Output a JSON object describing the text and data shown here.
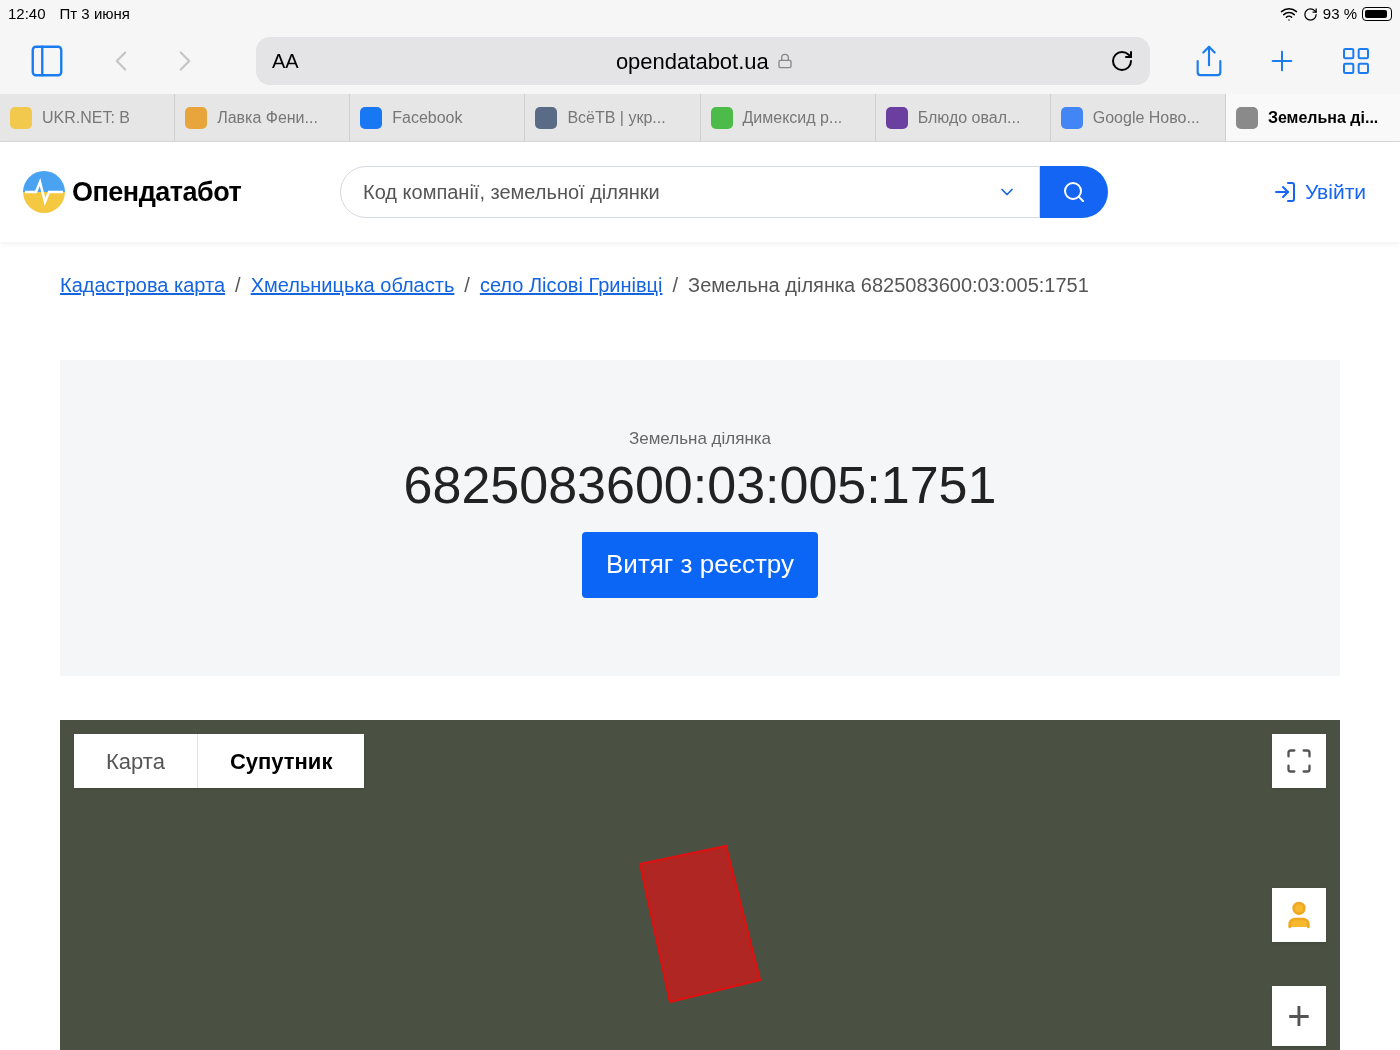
{
  "status_bar": {
    "time": "12:40",
    "date": "Пт 3 июня",
    "battery": "93 %"
  },
  "toolbar": {
    "text_size": "AA",
    "url": "opendatabot.ua"
  },
  "tabs": [
    {
      "label": "UKR.NET: В",
      "selected": false,
      "color": "#f2c94c"
    },
    {
      "label": "Лавка Фени...",
      "selected": false,
      "color": "#e8a53c"
    },
    {
      "label": "Facebook",
      "selected": false,
      "color": "#1877f2"
    },
    {
      "label": "ВсёТВ | укр...",
      "selected": false,
      "color": "#5a6b85"
    },
    {
      "label": "Димексид р...",
      "selected": false,
      "color": "#4cbb4a"
    },
    {
      "label": "Блюдо овал...",
      "selected": false,
      "color": "#6b3fa0"
    },
    {
      "label": "Google Ново...",
      "selected": false,
      "color": "#4285f4"
    },
    {
      "label": "Земельна ді...",
      "selected": true,
      "color": "#8a8a8a"
    }
  ],
  "header": {
    "logo": "Опендатабот",
    "search_placeholder": "Код компанії, земельної ділянки",
    "login": "Увійти"
  },
  "breadcrumbs": [
    {
      "label": "Кадастрова карта",
      "link": true
    },
    {
      "label": "Хмельницька область",
      "link": true
    },
    {
      "label": "село Лісові Гринівці",
      "link": true
    },
    {
      "label": "Земельна ділянка 6825083600:03:005:1751",
      "link": false
    }
  ],
  "breadcrumb_separator": "/",
  "parcel": {
    "caption": "Земельна ділянка",
    "number": "6825083600:03:005:1751",
    "button": "Витяг з реєстру"
  },
  "map": {
    "types": [
      {
        "label": "Карта",
        "selected": false
      },
      {
        "label": "Супутник",
        "selected": true
      }
    ],
    "zoom_in": "+"
  }
}
